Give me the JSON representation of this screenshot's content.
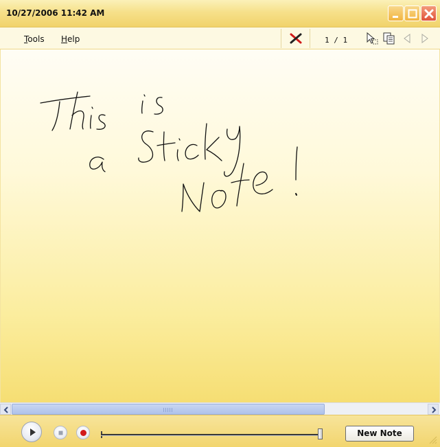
{
  "window": {
    "title": "10/27/2006 11:42 AM"
  },
  "menu": {
    "tools_mnemonic": "T",
    "tools_rest": "ools",
    "help_mnemonic": "H",
    "help_rest": "elp"
  },
  "toolbar": {
    "page_indicator": "1 / 1",
    "icons": [
      "delete-x-icon",
      "select-cursor-icon",
      "copy-icon",
      "previous-arrow-icon",
      "next-arrow-icon"
    ]
  },
  "note": {
    "handwriting_lines": [
      "This is",
      "a Sticky",
      "Note!"
    ]
  },
  "playback": {
    "position_fraction": 1.0
  },
  "actions": {
    "new_note_label": "New Note"
  },
  "colors": {
    "note_yellow": "#fbed9e",
    "title_yellow": "#f6e08a",
    "close_red": "#e0533a",
    "record_red": "#d21b1b"
  }
}
